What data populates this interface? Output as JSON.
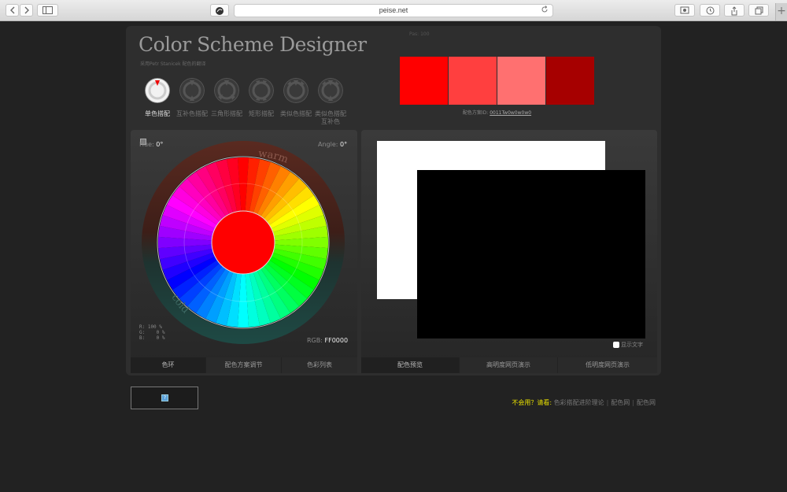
{
  "browser": {
    "url": "peise.net",
    "icons": {
      "back": "chevron-left-icon",
      "forward": "chevron-right-icon",
      "sidebar": "sidebar-icon",
      "reload": "reload-icon",
      "share": "share-icon",
      "tabs": "tabs-icon",
      "newtab": "plus-icon"
    },
    "newtab_label": "+"
  },
  "header": {
    "title": "Color Scheme Designer",
    "subtitle": "采用Petr Stanicek 配色的翻译",
    "top_label": "Pas: 100"
  },
  "schemes": [
    {
      "label": "单色搭配",
      "active": true
    },
    {
      "label": "互补色搭配",
      "active": false
    },
    {
      "label": "三角形搭配",
      "active": false
    },
    {
      "label": "矩形搭配",
      "active": false
    },
    {
      "label": "类似色搭配",
      "active": false
    },
    {
      "label": "类似色搭配互补色",
      "active": false
    }
  ],
  "swatches": [
    "#ff0000",
    "#ff3f3f",
    "#ff7070",
    "#a60000"
  ],
  "scheme_id": {
    "label": "配色方案ID: ",
    "value": "0011Tw0w0w0w0"
  },
  "wheel": {
    "hue_label": "Hue:",
    "hue_value": "0°",
    "angle_label": "Angle:",
    "angle_value": "0°",
    "warm": "warm",
    "cold": "cold",
    "rgb_values": "R: 100 %\nG:    0 %\nB:    0 %",
    "rgb_label": "RGB:",
    "rgb_hex": "FF0000",
    "center_color": "#ff0000"
  },
  "left_tabs": [
    "色环",
    "配色方案调节",
    "色彩列表"
  ],
  "right_tabs": [
    "配色预览",
    "高明度网页演示",
    "低明度网页演示"
  ],
  "preview": {
    "show_text": "显示文字"
  },
  "footer": {
    "question": "不会用？请看:",
    "links": [
      "色彩搭配进阶理论",
      "配色网",
      "配色网"
    ]
  }
}
